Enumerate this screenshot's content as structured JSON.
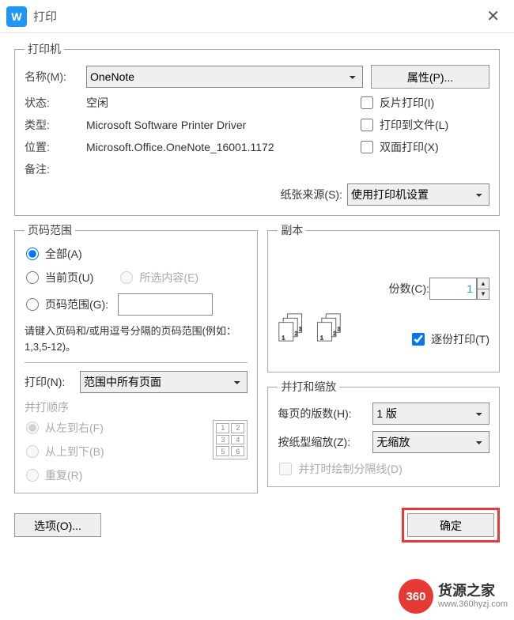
{
  "title": "打印",
  "printer": {
    "legend": "打印机",
    "name_label": "名称(M):",
    "name_value": "OneNote",
    "properties_btn": "属性(P)...",
    "status_label": "状态:",
    "status_value": "空闲",
    "inverse_label": "反片打印(I)",
    "type_label": "类型:",
    "type_value": "Microsoft Software Printer Driver",
    "tofile_label": "打印到文件(L)",
    "location_label": "位置:",
    "location_value": "Microsoft.Office.OneNote_16001.1172",
    "duplex_label": "双面打印(X)",
    "comment_label": "备注:",
    "paper_source_label": "纸张来源(S):",
    "paper_source_value": "使用打印机设置"
  },
  "range": {
    "legend": "页码范围",
    "all": "全部(A)",
    "current": "当前页(U)",
    "selection": "所选内容(E)",
    "pages": "页码范围(G):",
    "hint": "请键入页码和/或用逗号分隔的页码范围(例如：1,3,5-12)。",
    "print_label": "打印(N):",
    "print_value": "范围中所有页面",
    "order_legend": "并打顺序",
    "lr": "从左到右(F)",
    "tb": "从上到下(B)",
    "repeat": "重复(R)"
  },
  "copies": {
    "legend": "副本",
    "count_label": "份数(C):",
    "count_value": "1",
    "collate_label": "逐份打印(T)"
  },
  "scale": {
    "legend": "并打和缩放",
    "persheet_label": "每页的版数(H):",
    "persheet_value": "1 版",
    "scaleto_label": "按纸型缩放(Z):",
    "scaleto_value": "无缩放",
    "drawline_label": "并打时绘制分隔线(D)"
  },
  "buttons": {
    "options": "选项(O)...",
    "ok": "确定"
  },
  "brand": {
    "badge": "360",
    "cn": "货源之家",
    "url": "www.360hyzj.com"
  }
}
